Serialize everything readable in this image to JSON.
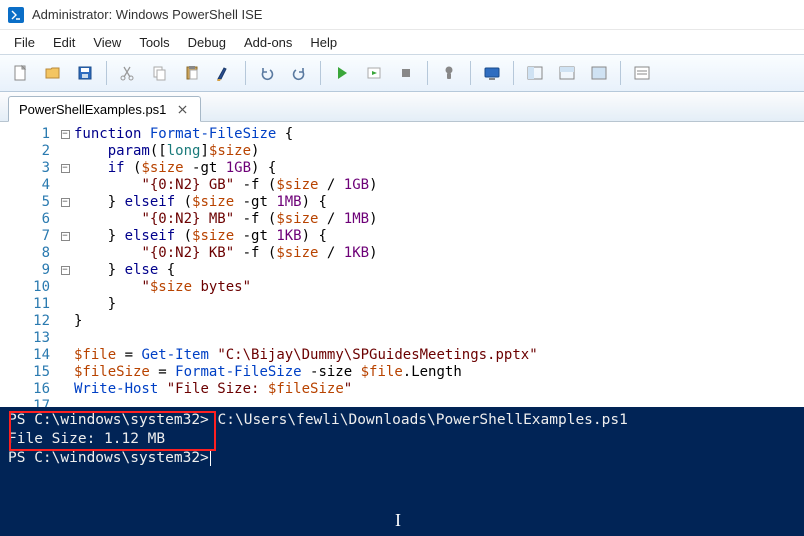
{
  "title": "Administrator: Windows PowerShell ISE",
  "menu": [
    "File",
    "Edit",
    "View",
    "Tools",
    "Debug",
    "Add-ons",
    "Help"
  ],
  "tab": {
    "name": "PowerShellExamples.ps1"
  },
  "code_lines": [
    "function Format-FileSize {",
    "    param([long]$size)",
    "    if ($size -gt 1GB) {",
    "        \"{0:N2} GB\" -f ($size / 1GB)",
    "    } elseif ($size -gt 1MB) {",
    "        \"{0:N2} MB\" -f ($size / 1MB)",
    "    } elseif ($size -gt 1KB) {",
    "        \"{0:N2} KB\" -f ($size / 1KB)",
    "    } else {",
    "        \"$size bytes\"",
    "    }",
    "}",
    "",
    "$file = Get-Item \"C:\\Bijay\\Dummy\\SPGuidesMeetings.pptx\"",
    "$fileSize = Format-FileSize -size $file.Length",
    "Write-Host \"File Size: $fileSize\"",
    ""
  ],
  "console": {
    "line1_prompt": "PS C:\\windows\\system32>",
    "line1_cmd": " C:\\Users\\fewli\\Downloads\\PowerShellExamples.ps1",
    "line2": "File Size: 1.12 MB",
    "line3": "",
    "line4_prompt": "PS C:\\windows\\system32>"
  }
}
